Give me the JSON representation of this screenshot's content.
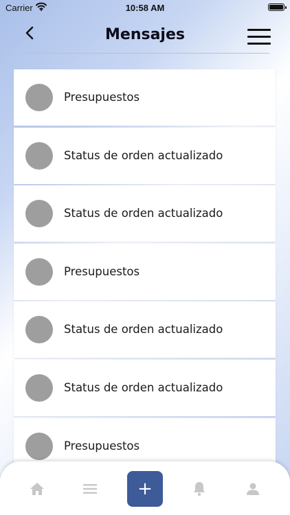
{
  "status_bar": {
    "carrier": "Carrier",
    "time": "10:58 AM"
  },
  "header": {
    "title": "Mensajes",
    "back_icon": "chevron-left-icon",
    "menu_icon": "hamburger-menu-icon"
  },
  "messages": [
    {
      "label": "Presupuestos"
    },
    {
      "label": "Status de orden actualizado"
    },
    {
      "label": "Status de orden actualizado"
    },
    {
      "label": "Presupuestos"
    },
    {
      "label": "Status de orden actualizado"
    },
    {
      "label": "Status de orden actualizado"
    },
    {
      "label": "Presupuestos"
    }
  ],
  "tabbar": {
    "home_icon": "home-icon",
    "list_icon": "list-icon",
    "add_label": "+",
    "bell_icon": "bell-icon",
    "user_icon": "user-icon"
  },
  "colors": {
    "accent": "#3d5a99",
    "avatar": "#9e9e9e",
    "tab_icon": "#c7c7c7"
  }
}
